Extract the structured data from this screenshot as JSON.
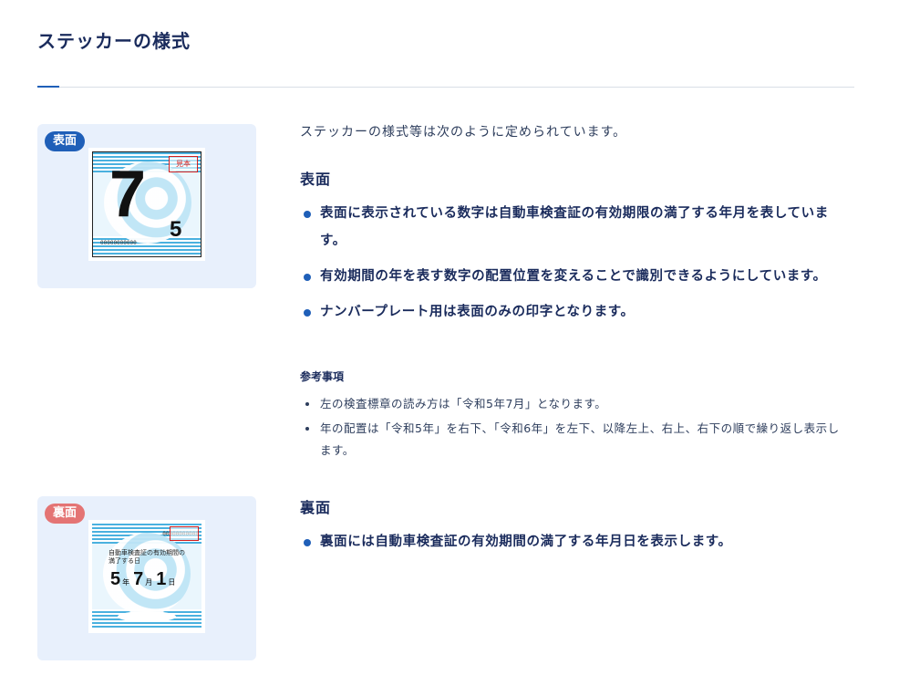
{
  "title": "ステッカーの様式",
  "intro": "ステッカーの様式等は次のように定められています。",
  "front": {
    "badge": "表面",
    "heading": "表面",
    "sticker": {
      "big_digit": "7",
      "small_digit": "5",
      "checkbox_text": "見本",
      "serial": "00000000000"
    },
    "bullets": [
      "表面に表示されている数字は自動車検査証の有効期限の満了する年月を表しています。",
      "有効期間の年を表す数字の配置位置を変えることで識別できるようにしています。",
      "ナンバープレート用は表面のみの印字となります。"
    ]
  },
  "reference": {
    "heading": "参考事項",
    "items": [
      "左の検査標章の読み方は「令和5年7月」となります。",
      "年の配置は「令和5年」を右下、「令和6年」を左下、以降左上、右上、右下の順で繰り返し表示します。"
    ]
  },
  "back": {
    "badge": "裏面",
    "heading": "裏面",
    "sticker": {
      "serial": "00000000000",
      "caption": "自動車検査証の有効期間の満了する日",
      "year": "5",
      "year_unit": "年",
      "month": "7",
      "month_unit": "月",
      "day": "1",
      "day_unit": "日"
    },
    "bullets": [
      "裏面には自動車検査証の有効期間の満了する年月日を表示します。"
    ]
  },
  "colors": {
    "accent": "#1f5fb8",
    "badge_back": "#e47474",
    "card_bg": "#e8f0fc",
    "heading": "#1a2b5c"
  }
}
